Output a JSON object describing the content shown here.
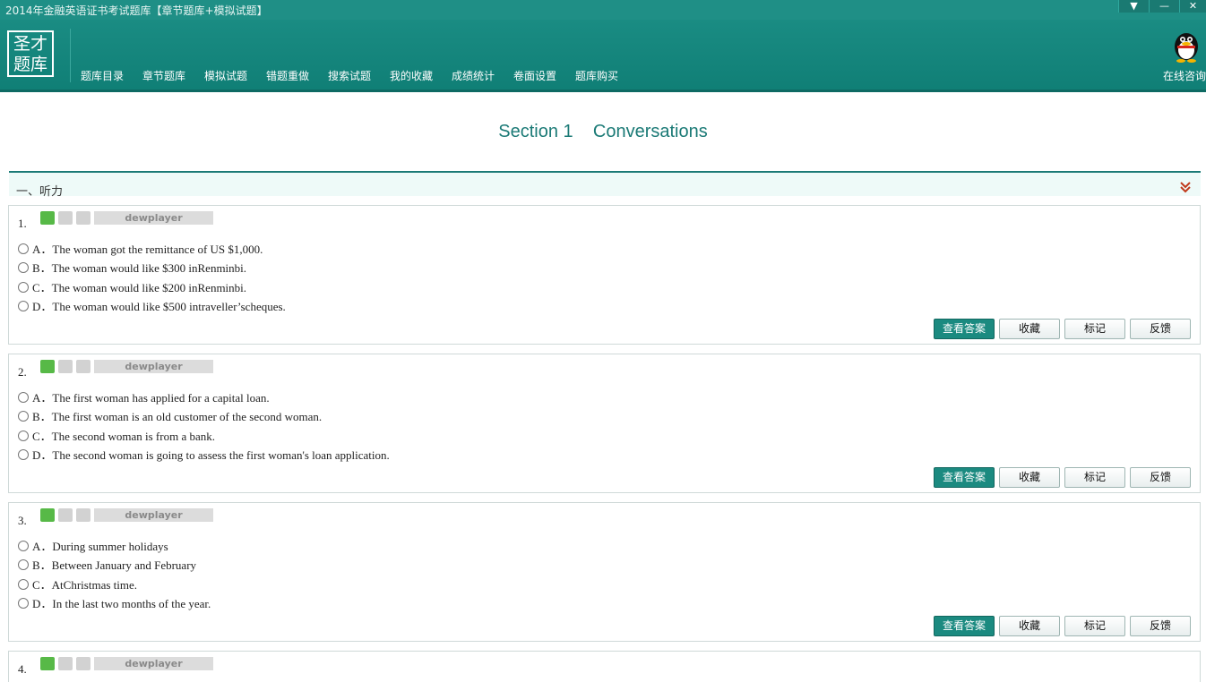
{
  "window": {
    "title": "2014年金融英语证书考试题库【章节题库+模拟试题】",
    "controls": {
      "menu": "▼",
      "minimize": "—",
      "close": "✕"
    }
  },
  "logo": {
    "line1": "圣才",
    "line2": "题库"
  },
  "nav": {
    "items": [
      {
        "label": "题库目录"
      },
      {
        "label": "章节题库"
      },
      {
        "label": "模拟试题"
      },
      {
        "label": "错题重做"
      },
      {
        "label": "搜索试题"
      },
      {
        "label": "我的收藏"
      },
      {
        "label": "成绩统计"
      },
      {
        "label": "卷面设置"
      },
      {
        "label": "题库购买"
      }
    ],
    "consult_label": "在线咨询"
  },
  "section_title": "Section 1    Conversations",
  "part": {
    "label": "一、听力"
  },
  "player_label": "dewplayer",
  "actions": {
    "view_answer": "查看答案",
    "favorite": "收藏",
    "mark": "标记",
    "feedback": "反馈"
  },
  "questions": [
    {
      "number": "1.",
      "options": [
        "A．The woman got the remittance of US $1,000.",
        "B．The woman would like $300 inRenminbi.",
        "C．The woman would like $200 inRenminbi.",
        "D．The woman would like $500 intraveller’scheques."
      ]
    },
    {
      "number": "2.",
      "options": [
        "A．The first woman has applied for a capital loan.",
        "B．The first woman is an old customer of the second woman.",
        "C．The second woman is from a bank.",
        "D．The second woman is going to assess the first woman's loan application."
      ]
    },
    {
      "number": "3.",
      "options": [
        "A．During summer holidays",
        "B．Between January and February",
        "C．AtChristmas time.",
        "D．In the last two months of the year."
      ]
    },
    {
      "number": "4.",
      "options": []
    }
  ],
  "colors": {
    "accent": "#1b8a80",
    "header": "#1a8c83",
    "play": "#57b947"
  }
}
